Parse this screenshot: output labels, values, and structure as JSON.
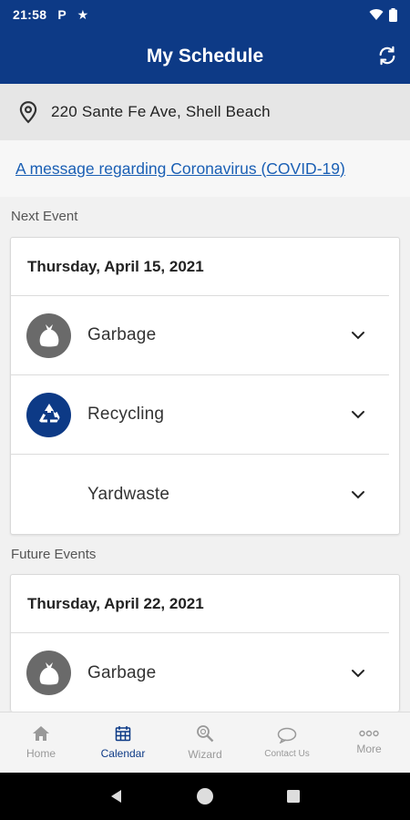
{
  "status_bar": {
    "time": "21:58",
    "icon1": "P",
    "icon2": "★"
  },
  "app_bar": {
    "title": "My Schedule",
    "refresh_icon": "refresh-icon"
  },
  "address": {
    "text": "220 Sante Fe Ave, Shell Beach"
  },
  "message": {
    "link_text": "A message regarding Coronavirus (COVID-19)"
  },
  "next_event": {
    "section_label": "Next Event",
    "date": "Thursday, April 15, 2021",
    "items": [
      {
        "label": "Garbage",
        "icon": "garbage-bag-icon"
      },
      {
        "label": "Recycling",
        "icon": "recycling-icon"
      },
      {
        "label": "Yardwaste",
        "icon": ""
      }
    ]
  },
  "future_events": {
    "section_label": "Future Events",
    "date": "Thursday, April 22, 2021",
    "items": [
      {
        "label": "Garbage",
        "icon": "garbage-bag-icon"
      }
    ]
  },
  "bottom_nav": {
    "items": [
      {
        "label": "Home",
        "icon": "home-icon"
      },
      {
        "label": "Calendar",
        "icon": "calendar-icon",
        "active": true
      },
      {
        "label": "Wizard",
        "icon": "search-icon"
      },
      {
        "label": "Contact Us",
        "icon": "chat-bubble-icon"
      },
      {
        "label": "More",
        "icon": "more-dots-icon"
      }
    ]
  },
  "colors": {
    "primary": "#0d3a86",
    "link": "#1a5fb4",
    "garbage_icon_bg": "#6a6a6a"
  }
}
